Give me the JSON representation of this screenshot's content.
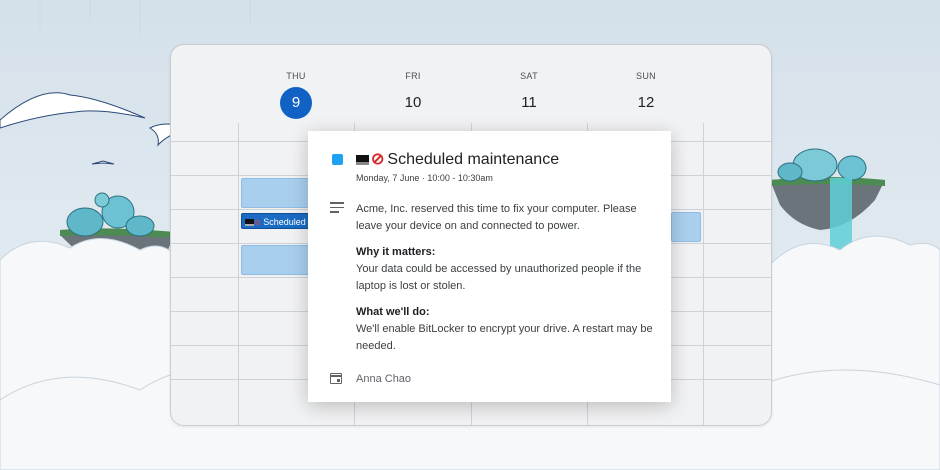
{
  "calendar": {
    "days": [
      {
        "dow": "THU",
        "date": "9",
        "today": true
      },
      {
        "dow": "FRI",
        "date": "10",
        "today": false
      },
      {
        "dow": "SAT",
        "date": "11",
        "today": false
      },
      {
        "dow": "SUN",
        "date": "12",
        "today": false
      }
    ],
    "selected_event_label": "Scheduled"
  },
  "event": {
    "title": "Scheduled maintenance",
    "datetime": "Monday, 7 June  ·  10:00 - 10:30am",
    "description": "Acme, Inc. reserved this time to fix your computer. Please leave your device on and connected to power.",
    "why_heading": "Why it matters:",
    "why_text": "Your data could be accessed by unauthorized people if the laptop is lost or stolen.",
    "what_heading": "What we'll do:",
    "what_text": "We'll enable BitLocker to encrypt your drive. A restart may be needed.",
    "organizer": "Anna Chao",
    "color": "#1da1f2"
  },
  "icons": [
    "laptop-icon",
    "prohibited-icon",
    "description-icon",
    "calendar-icon"
  ]
}
